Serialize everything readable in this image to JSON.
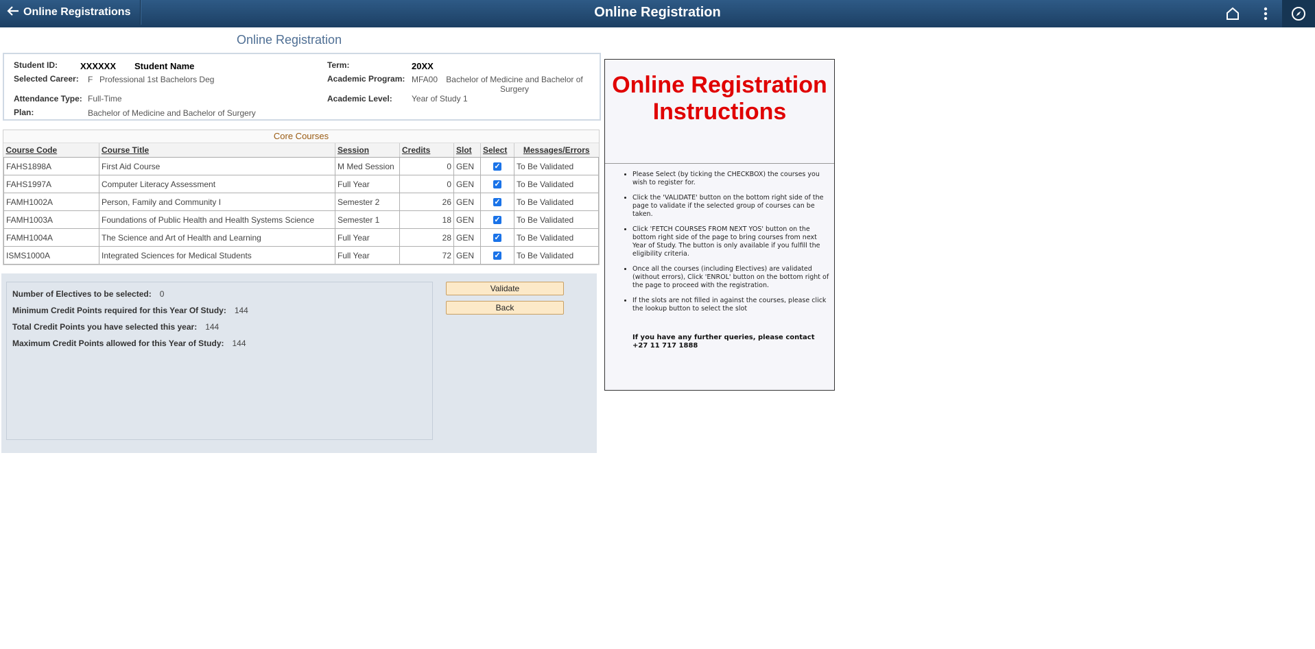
{
  "topbar": {
    "back_label": "Online Registrations",
    "title": "Online Registration",
    "icons": [
      "home-icon",
      "more-vert-icon",
      "compass-icon"
    ]
  },
  "page_title": "Online Registration",
  "student": {
    "id_label": "Student ID:",
    "id_value": "XXXXXX",
    "name_value": "Student Name",
    "term_label": "Term:",
    "term_value": "20XX",
    "career_label": "Selected Career:",
    "career_code": "F",
    "career_value": "Professional 1st Bachelors Deg",
    "program_label": "Academic Program:",
    "program_code": "MFA00",
    "program_value": "Bachelor of Medicine and Bachelor of Surgery",
    "attendance_label": "Attendance Type:",
    "attendance_value": "Full-Time",
    "level_label": "Academic Level:",
    "level_value": "Year of Study 1",
    "plan_label": "Plan:",
    "plan_value": "Bachelor of Medicine and Bachelor of Surgery"
  },
  "courses": {
    "title": "Core Courses",
    "headers": {
      "code": "Course Code",
      "title": "Course Title",
      "session": "Session",
      "credits": "Credits",
      "slot": "Slot",
      "select": "Select",
      "messages": "Messages/Errors"
    },
    "rows": [
      {
        "code": "FAHS1898A",
        "title": "First Aid Course",
        "session": "M Med Session",
        "credits": "0",
        "slot": "GEN",
        "selected": true,
        "message": "To Be Validated"
      },
      {
        "code": "FAHS1997A",
        "title": "Computer Literacy Assessment",
        "session": "Full Year",
        "credits": "0",
        "slot": "GEN",
        "selected": true,
        "message": "To Be Validated"
      },
      {
        "code": "FAMH1002A",
        "title": "Person, Family and Community I",
        "session": "Semester 2",
        "credits": "26",
        "slot": "GEN",
        "selected": true,
        "message": "To Be Validated"
      },
      {
        "code": "FAMH1003A",
        "title": "Foundations of Public Health and Health Systems Science",
        "session": "Semester 1",
        "credits": "18",
        "slot": "GEN",
        "selected": true,
        "message": "To Be Validated"
      },
      {
        "code": "FAMH1004A",
        "title": "The Science and Art of Health and Learning",
        "session": "Full Year",
        "credits": "28",
        "slot": "GEN",
        "selected": true,
        "message": "To Be Validated"
      },
      {
        "code": "ISMS1000A",
        "title": "Integrated Sciences for Medical Students",
        "session": "Full Year",
        "credits": "72",
        "slot": "GEN",
        "selected": true,
        "message": "To Be Validated"
      }
    ]
  },
  "summary": {
    "electives_label": "Number of Electives to be selected:",
    "electives_value": "0",
    "min_label": "Minimum Credit Points required for this Year Of Study:",
    "min_value": "144",
    "total_label": "Total Credit Points you have selected this year:",
    "total_value": "144",
    "max_label": "Maximum Credit Points allowed for this Year of Study:",
    "max_value": "144"
  },
  "buttons": {
    "validate": "Validate",
    "back": "Back"
  },
  "instructions": {
    "title": "Online Registration Instructions",
    "items": [
      "Please Select (by ticking the CHECKBOX) the courses you wish to register for.",
      "Click the 'VALIDATE' button on the bottom right side of the page to validate if the selected group of courses can be taken.",
      "Click 'FETCH COURSES FROM NEXT YOS' button on the bottom right side of the page to bring courses from next Year of Study. The button is only available if you fulfill the eligibility criteria.",
      "Once all the courses (including Electives) are validated (without errors), Click 'ENROL' button on the bottom right of the page to proceed with the registration.",
      "If the slots are not filled in against the courses, please click the lookup button to select the slot"
    ],
    "contact_line1": "If you have any further queries, please contact",
    "contact_line2": "+27 11 717 1888"
  }
}
